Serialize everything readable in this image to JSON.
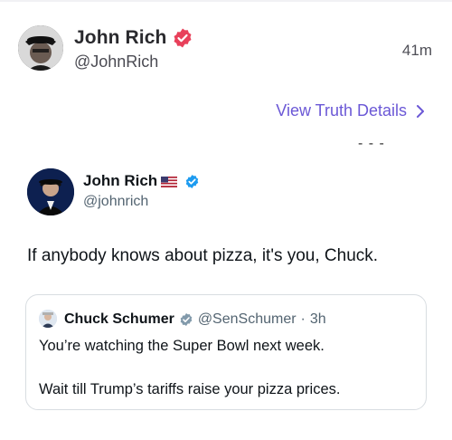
{
  "post": {
    "display_name": "John Rich",
    "handle": "@JohnRich",
    "time": "41m",
    "details_link": "View Truth Details",
    "separator": "- - -",
    "colors": {
      "verified_badge": "#e8405a",
      "link": "#6b58d6"
    }
  },
  "embedded_tweet": {
    "display_name": "John Rich",
    "flag": "us-flag-emoji",
    "handle": "@johnrich",
    "text": "If anybody knows about pizza, it's you, Chuck.",
    "colors": {
      "verified_badge": "#1d9bf0"
    },
    "quoted_tweet": {
      "display_name": "Chuck Schumer",
      "handle": "@SenSchumer",
      "separator": "·",
      "time": "3h",
      "line1": "You’re watching the Super Bowl next week.",
      "line2": "Wait till Trump’s tariffs raise your pizza prices.",
      "colors": {
        "verified_badge": "#829aab"
      }
    }
  }
}
